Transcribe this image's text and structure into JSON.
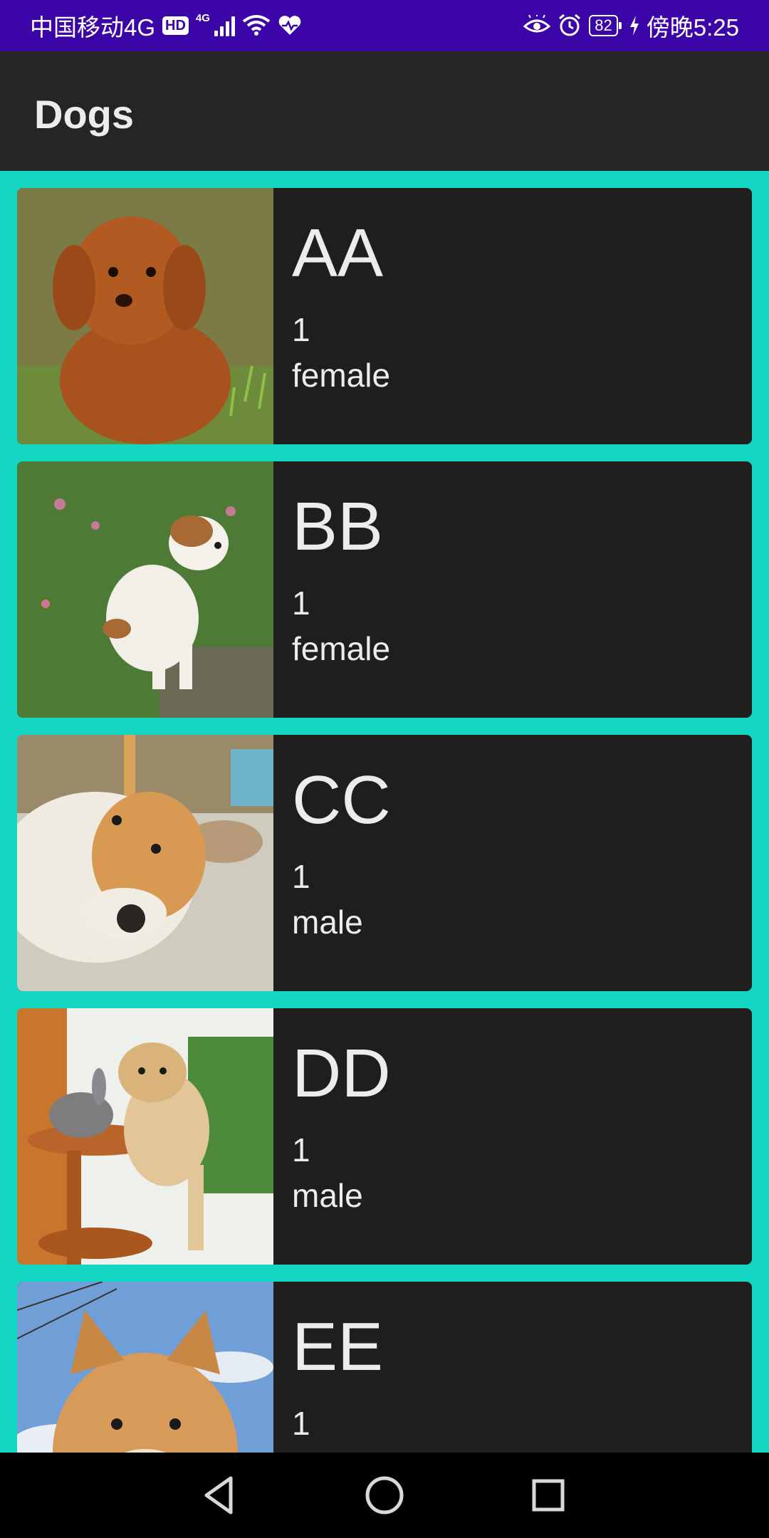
{
  "status_bar": {
    "carrier": "中国移动4G",
    "hd_badge": "HD",
    "network_type": "4G",
    "battery": "82",
    "time_label": "傍晚5:25",
    "color": "#3b05a8"
  },
  "app_bar": {
    "title": "Dogs",
    "background": "#262526"
  },
  "list": {
    "background": "#12d6bf",
    "dogs": [
      {
        "name": "AA",
        "age": "1",
        "gender": "female",
        "photo": "brown poodle puppy"
      },
      {
        "name": "BB",
        "age": "1",
        "gender": "female",
        "photo": "white brown puppy in grass"
      },
      {
        "name": "CC",
        "age": "1",
        "gender": "male",
        "photo": "shiba lying down"
      },
      {
        "name": "DD",
        "age": "1",
        "gender": "male",
        "photo": "puppy with rabbit"
      },
      {
        "name": "EE",
        "age": "1",
        "gender": "",
        "photo": "shiba puppy sky"
      }
    ]
  },
  "icons": {
    "eye": "eye-icon",
    "alarm": "alarm-icon",
    "wifi": "wifi-icon",
    "health": "heart-icon",
    "charging": "lightning-icon",
    "nav_back": "back-triangle-icon",
    "nav_home": "home-circle-icon",
    "nav_recents": "recents-square-icon"
  }
}
